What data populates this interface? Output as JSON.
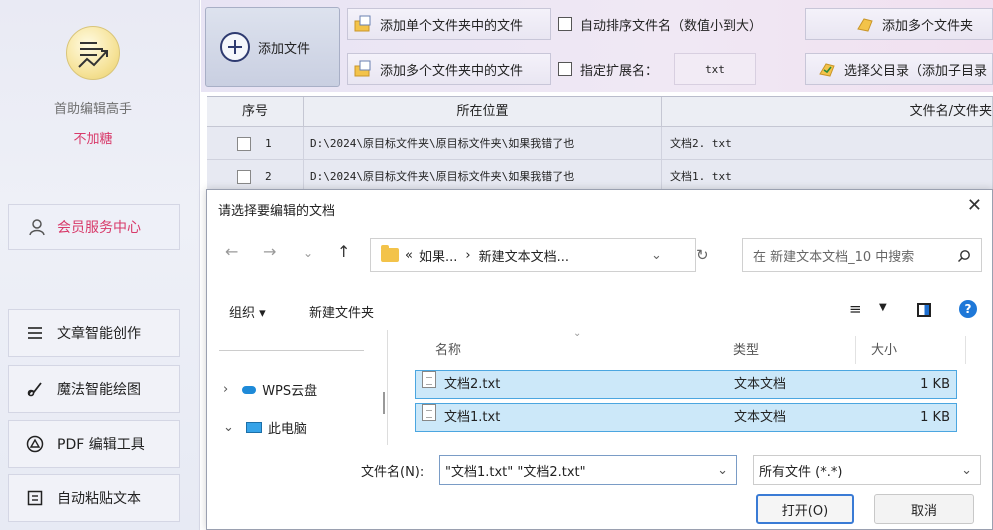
{
  "sidebar": {
    "app_name": "首助编辑高手",
    "app_sub": "不加糖",
    "member_center": "会员服务中心",
    "items": [
      {
        "label": "文章智能创作",
        "icon": "list-icon"
      },
      {
        "label": "魔法智能绘图",
        "icon": "brush-icon"
      },
      {
        "label": "PDF 编辑工具",
        "icon": "pdf-icon"
      },
      {
        "label": "自动粘贴文本",
        "icon": "paste-icon"
      }
    ]
  },
  "toolbar": {
    "add_file": "添加文件",
    "add_single_folder": "添加单个文件夹中的文件",
    "add_multi_folder": "添加多个文件夹中的文件",
    "auto_sort": "自动排序文件名（数值小到大）",
    "specify_ext": "指定扩展名：",
    "ext_value": "txt",
    "add_multi_folders": "添加多个文件夹",
    "select_parent": "选择父目录（添加子目录"
  },
  "table": {
    "headers": [
      "序号",
      "所在位置",
      "文件名/文件夹"
    ],
    "rows": [
      {
        "index": "1",
        "location": "D:\\2024\\原目标文件夹\\原目标文件夹\\如果我错了也",
        "name": "文档2. txt"
      },
      {
        "index": "2",
        "location": "D:\\2024\\原目标文件夹\\原目标文件夹\\如果我错了也",
        "name": "文档1. txt"
      }
    ]
  },
  "dialog": {
    "title": "请选择要编辑的文档",
    "close": "✕",
    "breadcrumb_prefix": "«",
    "breadcrumb_1": "如果...",
    "breadcrumb_sep": "›",
    "breadcrumb_2": "新建文本文档...",
    "search_placeholder": "在 新建文本文档_10 中搜索",
    "organize": "组织 ▾",
    "new_folder": "新建文件夹",
    "nav_items": [
      {
        "label": "WPS云盘",
        "chevron": "›"
      },
      {
        "label": "此电脑",
        "chevron": "⌄"
      }
    ],
    "columns": {
      "name": "名称",
      "type": "类型",
      "size": "大小"
    },
    "files": [
      {
        "name": "文档2.txt",
        "type": "文本文档",
        "size": "1 KB"
      },
      {
        "name": "文档1.txt",
        "type": "文本文档",
        "size": "1 KB"
      }
    ],
    "filename_label": "文件名(N):",
    "filename_value": "\"文档1.txt\" \"文档2.txt\"",
    "filetype": "所有文件 (*.*)",
    "open_button": "打开(O)",
    "cancel_button": "取消"
  }
}
